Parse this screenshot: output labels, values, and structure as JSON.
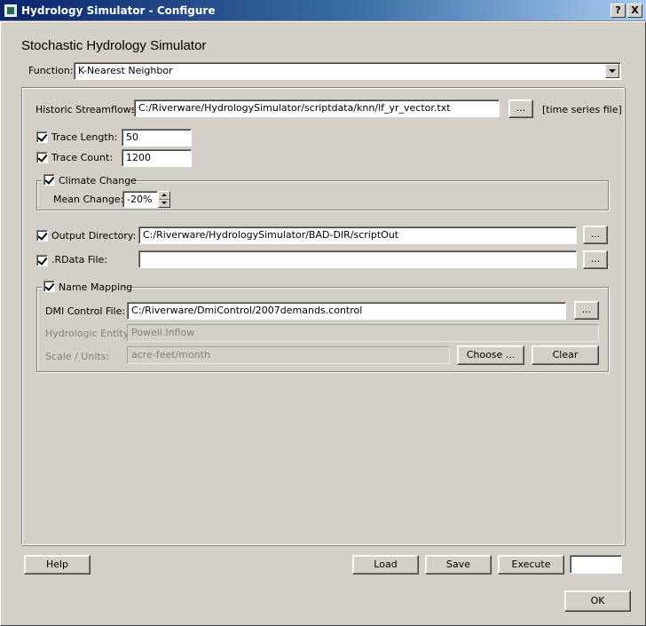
{
  "window": {
    "title": "Hydrology Simulator - Configure",
    "help_btn": "?",
    "close_btn": "X"
  },
  "heading": "Stochastic Hydrology Simulator",
  "function": {
    "label": "Function:",
    "value": "K-Nearest Neighbor"
  },
  "streamflows": {
    "label": "Historic Streamflows:",
    "value": "C:/Riverware/HydrologySimulator/scriptdata/knn/lf_yr_vector.txt",
    "browse": "...",
    "note": "[time series file]"
  },
  "trace_length": {
    "label": "Trace Length:",
    "value": "50",
    "checked": true
  },
  "trace_count": {
    "label": "Trace Count:",
    "value": "1200",
    "checked": true
  },
  "climate": {
    "label": "Climate Change",
    "checked": true,
    "mean_label": "Mean Change:",
    "mean_value": "-20%"
  },
  "output_dir": {
    "label": "Output Directory:",
    "checked": true,
    "value": "C:/Riverware/HydrologySimulator/BAD-DIR/scriptOut",
    "browse": "..."
  },
  "rdata": {
    "label": ".RData File:",
    "checked": true,
    "value": "",
    "browse": "..."
  },
  "name_mapping": {
    "label": "Name Mapping",
    "checked": true,
    "dmi_label": "DMI Control File:",
    "dmi_value": "C:/Riverware/DmiControl/2007demands.control",
    "dmi_browse": "...",
    "entity_label": "Hydrologic Entity:",
    "entity_value": "Powell.Inflow",
    "scale_label": "Scale / Units:",
    "scale_value": "acre-feet/month",
    "choose": "Choose ...",
    "clear": "Clear"
  },
  "footer": {
    "help": "Help",
    "load": "Load",
    "save": "Save",
    "execute": "Execute",
    "status_value": "",
    "ok": "OK"
  }
}
